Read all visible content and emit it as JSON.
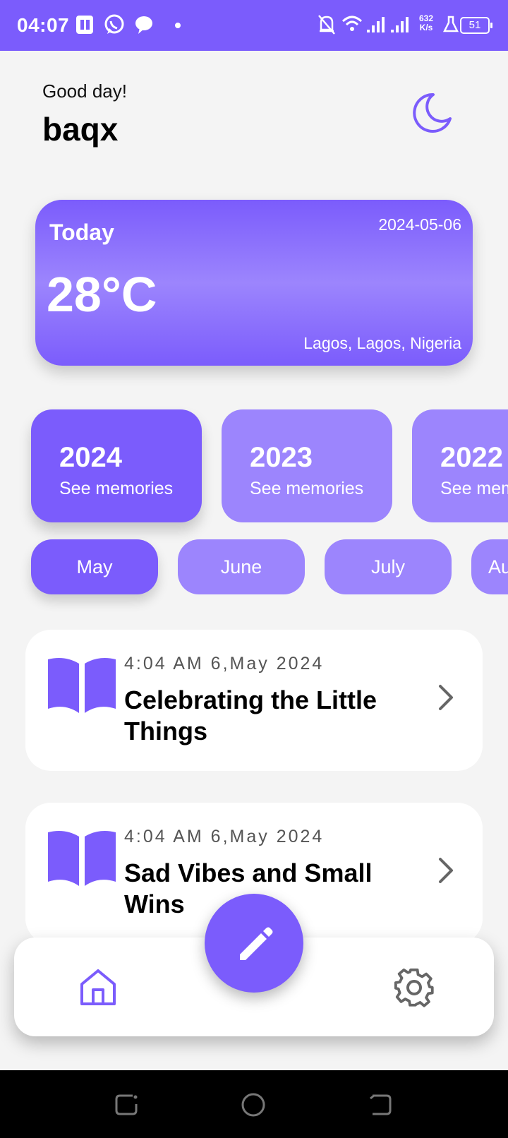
{
  "status_bar": {
    "time": "04:07",
    "speed_value": "632",
    "speed_unit": "K/s",
    "battery": "51"
  },
  "header": {
    "greeting": "Good day!",
    "username": "baqx"
  },
  "weather": {
    "label": "Today",
    "date": "2024-05-06",
    "temperature": "28°C",
    "location": "Lagos, Lagos, Nigeria"
  },
  "years": [
    {
      "year": "2024",
      "subtitle": "See memories",
      "active": true
    },
    {
      "year": "2023",
      "subtitle": "See memories",
      "active": false
    },
    {
      "year": "2022",
      "subtitle": "See memories",
      "active": false
    }
  ],
  "months": [
    {
      "label": "May",
      "active": true
    },
    {
      "label": "June",
      "active": false
    },
    {
      "label": "July",
      "active": false
    },
    {
      "label": "August",
      "active": false
    }
  ],
  "entries": [
    {
      "timestamp": "4:04 AM 6,May 2024",
      "title": "Celebrating the Little Things"
    },
    {
      "timestamp": "4:04 AM 6,May 2024",
      "title": "Sad Vibes and Small Wins"
    }
  ],
  "colors": {
    "accent": "#7b5cfc",
    "accent_light": "#9c85fd",
    "background": "#f4f4f4"
  },
  "icons": {
    "theme": "moon-icon",
    "entry": "open-book-icon",
    "fab": "pencil-icon",
    "nav_home": "home-icon",
    "nav_settings": "gear-icon"
  }
}
